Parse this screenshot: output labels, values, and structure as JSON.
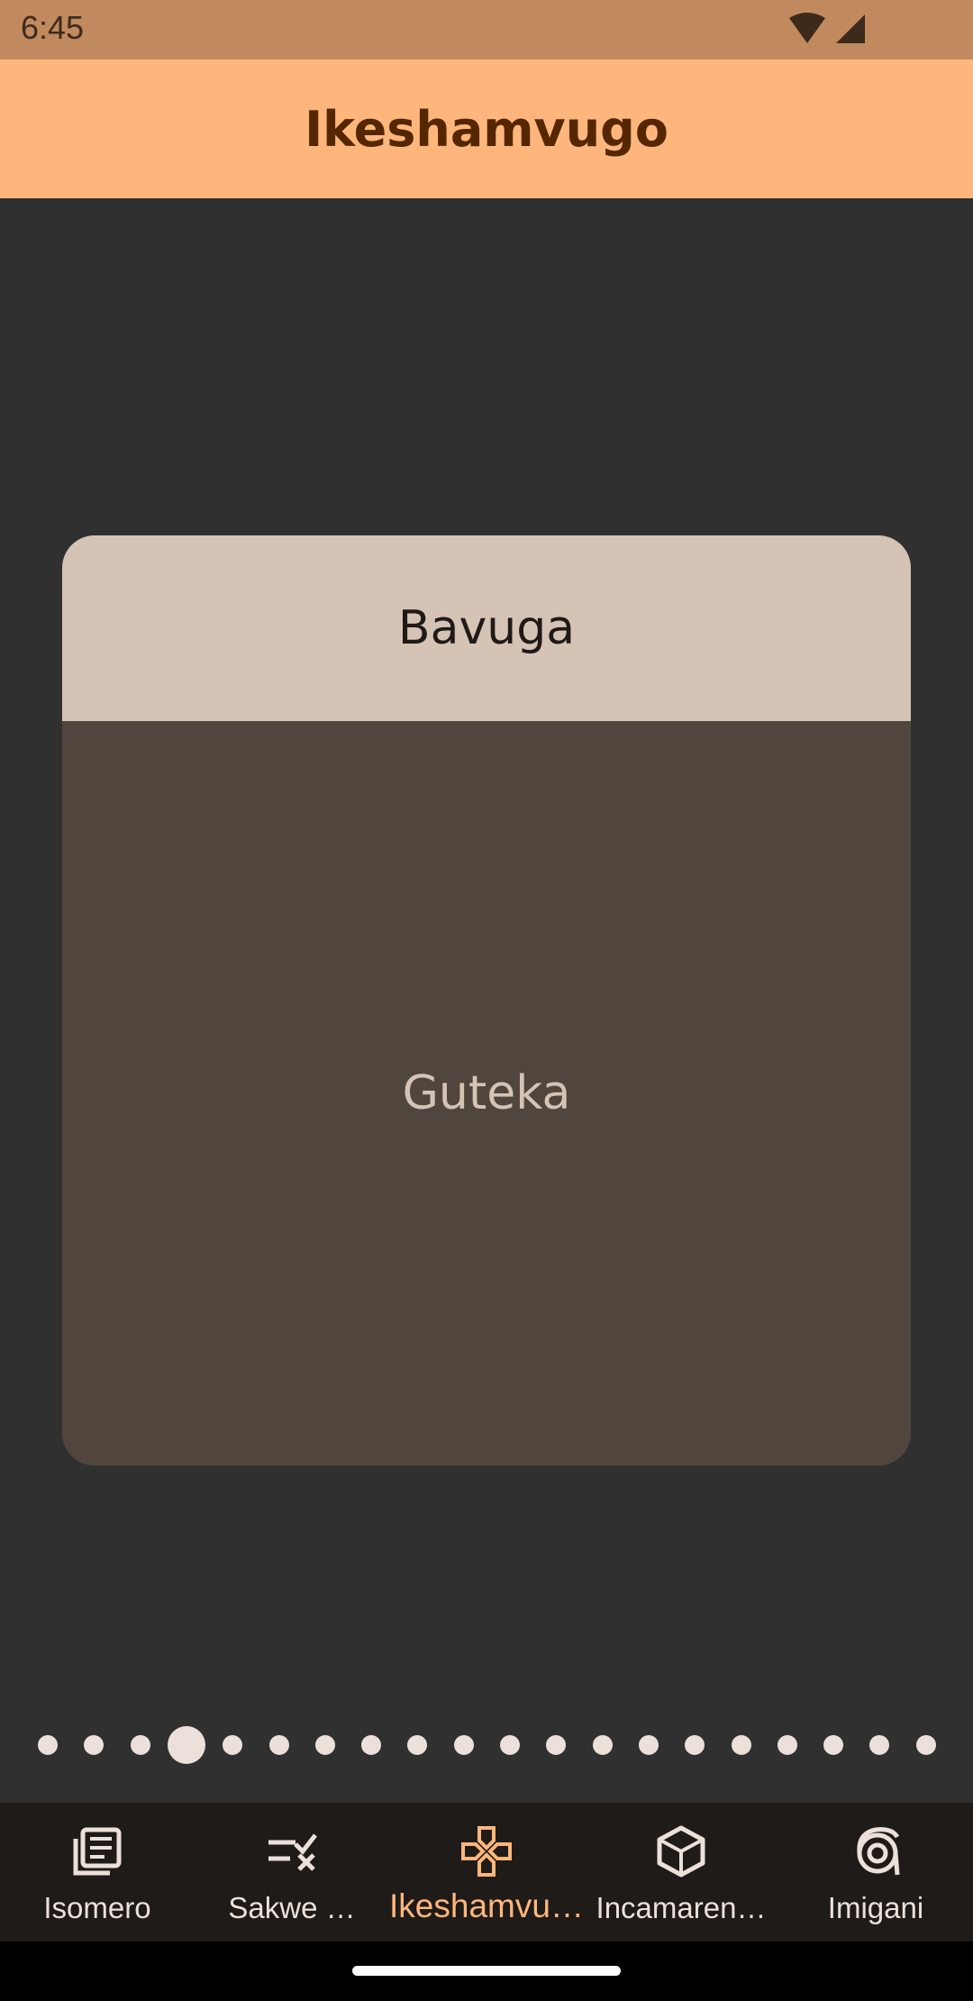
{
  "status_bar": {
    "time": "6:45",
    "icons": [
      "wifi-icon",
      "cellular-signal-icon"
    ]
  },
  "app_bar": {
    "title": "Ikeshamvugo"
  },
  "card": {
    "header": "Bavuga",
    "body": "Guteka"
  },
  "pager": {
    "total": 20,
    "current_index": 3
  },
  "bottom_nav": {
    "items": [
      {
        "label": "Isomero",
        "icon": "article-icon",
        "active": false
      },
      {
        "label": "Sakwe …",
        "icon": "checklist-icon",
        "active": false
      },
      {
        "label": "Ikeshamvu…",
        "icon": "gamepad-icon",
        "active": true
      },
      {
        "label": "Incamaren…",
        "icon": "cube-icon",
        "active": false
      },
      {
        "label": "Imigani",
        "icon": "spiral-icon",
        "active": false
      }
    ]
  },
  "colors": {
    "status_bar": "#c08a5e",
    "app_bar": "#ffb67c",
    "title_text": "#552700",
    "background": "#303030",
    "card_header": "#d5c3b6",
    "card_body": "#51463d",
    "nav_background": "#1f1b18",
    "nav_active": "#ffb67c",
    "nav_inactive": "#ece0da"
  }
}
